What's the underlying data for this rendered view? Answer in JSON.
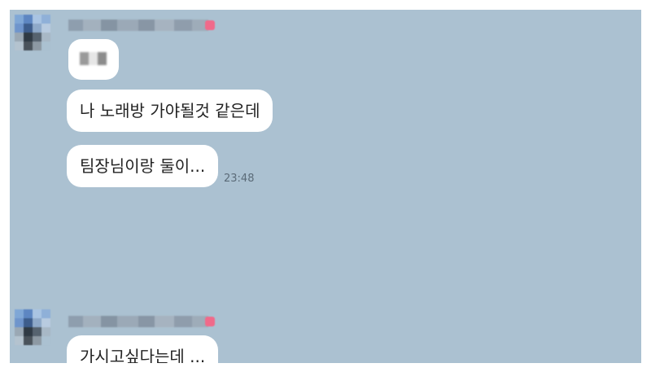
{
  "chat": {
    "background_color": "#abc1d1",
    "messages": [
      {
        "text": "나 노래방 가야될것 같은데"
      },
      {
        "text": "팀장님이랑 둘이...",
        "time": "23:48"
      },
      {
        "text": "가시고싶다는데 ..."
      }
    ],
    "icons": {
      "avatar_1": "blurred-profile-avatar",
      "avatar_2": "blurred-profile-avatar",
      "emoji": "blurred-emoji-sticker",
      "name_badge": "heart-icon"
    }
  }
}
